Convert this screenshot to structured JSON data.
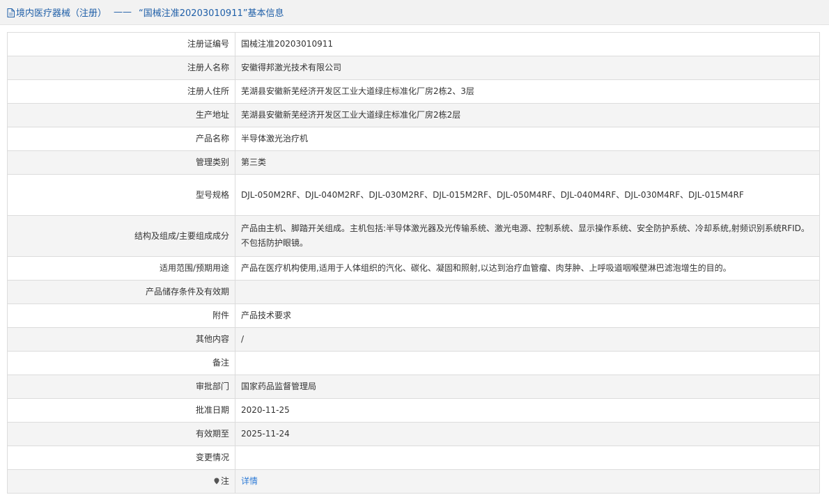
{
  "header": {
    "prefix": "境内医疗器械（注册）",
    "separator": "——",
    "title": "“国械注准20203010911”基本信息",
    "colors": {
      "title": "#1f5fa8",
      "link": "#2e7bd6"
    },
    "icon": "document-icon"
  },
  "rows": [
    {
      "label": "注册证编号",
      "value": "国械注准20203010911"
    },
    {
      "label": "注册人名称",
      "value": "安徽得邦激光技术有限公司"
    },
    {
      "label": "注册人住所",
      "value": "芜湖县安徽新芜经济开发区工业大道绿庄标准化厂房2栋2、3层"
    },
    {
      "label": "生产地址",
      "value": "芜湖县安徽新芜经济开发区工业大道绿庄标准化厂房2栋2层"
    },
    {
      "label": "产品名称",
      "value": "半导体激光治疗机"
    },
    {
      "label": "管理类别",
      "value": "第三类"
    },
    {
      "label": "型号规格",
      "value": "DJL-050M2RF、DJL-040M2RF、DJL-030M2RF、DJL-015M2RF、DJL-050M4RF、DJL-040M4RF、DJL-030M4RF、DJL-015M4RF"
    },
    {
      "label": "结构及组成/主要组成成分",
      "value": "产品由主机、脚踏开关组成。主机包括:半导体激光器及光传输系统、激光电源、控制系统、显示操作系统、安全防护系统、冷却系统,射频识别系统RFID。不包括防护眼镜。"
    },
    {
      "label": "适用范围/预期用途",
      "value": "产品在医疗机构使用,适用于人体组织的汽化、碳化、凝固和照射,以达到治疗血管瘤、肉芽肿、上呼吸道咽喉壁淋巴滤泡增生的目的。"
    },
    {
      "label": "产品储存条件及有效期",
      "value": ""
    },
    {
      "label": "附件",
      "value": "产品技术要求"
    },
    {
      "label": "其他内容",
      "value": "/"
    },
    {
      "label": "备注",
      "value": ""
    },
    {
      "label": "审批部门",
      "value": "国家药品监督管理局"
    },
    {
      "label": "批准日期",
      "value": "2020-11-25"
    },
    {
      "label": "有效期至",
      "value": "2025-11-24"
    },
    {
      "label": "变更情况",
      "value": ""
    },
    {
      "label": "注",
      "value": "详情",
      "icon": "pin-icon"
    }
  ]
}
